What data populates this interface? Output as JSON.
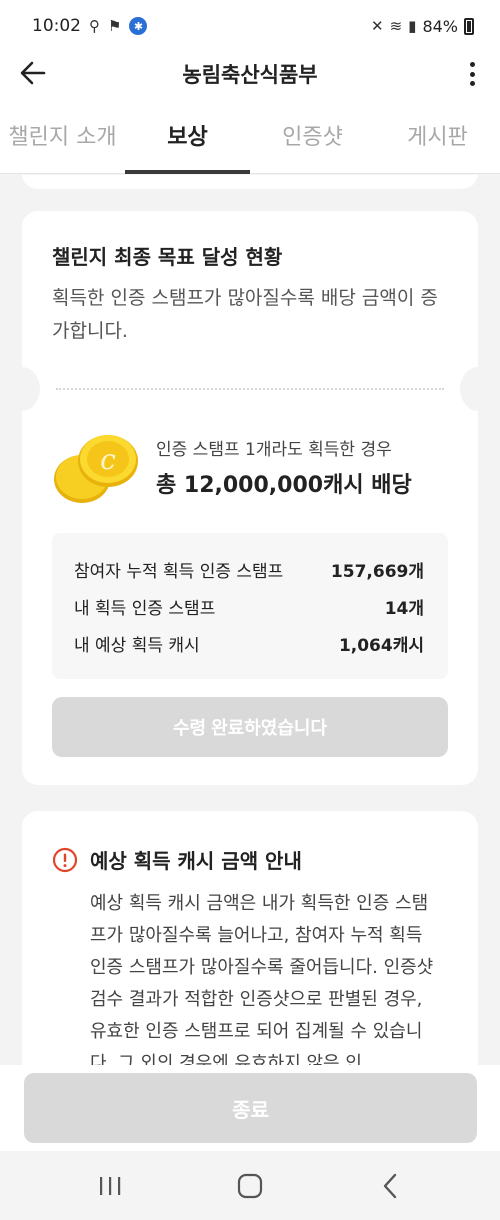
{
  "status_bar": {
    "time": "10:02",
    "battery": "84%"
  },
  "app_bar": {
    "title": "농림축산식품부"
  },
  "tabs": [
    {
      "label": "챌린지 소개",
      "active": false
    },
    {
      "label": "보상",
      "active": true
    },
    {
      "label": "인증샷",
      "active": false
    },
    {
      "label": "게시판",
      "active": false
    }
  ],
  "goal_card": {
    "heading": "챌린지 최종 목표 달성 현황",
    "description": "획득한 인증 스탬프가 많아질수록 배당 금액이 증가합니다.",
    "reward_condition": "인증 스탬프 1개라도 획득한 경우",
    "reward_amount": "총 12,000,000캐시 배당",
    "stats": [
      {
        "label": "참여자 누적 획득 인증 스탬프",
        "value": "157,669개"
      },
      {
        "label": "내 획득 인증 스탬프",
        "value": "14개"
      },
      {
        "label": "내 예상 획득 캐시",
        "value": "1,064캐시"
      }
    ],
    "claim_button": "수령 완료하였습니다"
  },
  "notice_card": {
    "title": "예상 획득 캐시 금액 안내",
    "body": "예상 획득 캐시 금액은 내가 획득한 인증 스탬프가 많아질수록 늘어나고, 참여자 누적 획득 인증 스탬프가 많아질수록 줄어듭니다. 인증샷 검수 결과가 적합한 인증샷으로 판별된 경우, 유효한 인증 스탬프로 되어 집계될 수 있습니다. 그 외의 경우엔 유효하지 않은 인"
  },
  "bottom": {
    "end_button": "종료"
  },
  "colors": {
    "coin": "#f2c418",
    "warning": "#e0452a",
    "disabled_button": "#d9d9d9"
  }
}
